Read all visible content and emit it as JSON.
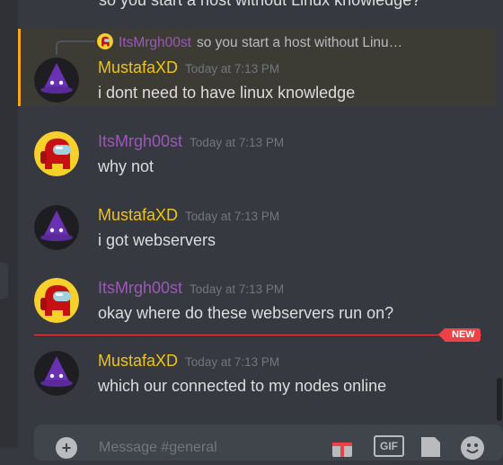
{
  "overflow_top_text": "so you start a host without Linux knowledge?",
  "reply": {
    "username": "ItsMrgh00st",
    "text": "so you start a host without Linu…"
  },
  "messages": [
    {
      "username": "MustafaXD",
      "timestamp": "Today at 7:13 PM",
      "text": "i dont need to have linux knowledge",
      "color": "#f1c40f",
      "avatar": "wizard-avatar"
    },
    {
      "username": "ItsMrgh00st",
      "timestamp": "Today at 7:13 PM",
      "text": "why not",
      "color": "#9b59b6",
      "avatar": "crewmate-avatar"
    },
    {
      "username": "MustafaXD",
      "timestamp": "Today at 7:13 PM",
      "text": "i got webservers",
      "color": "#f1c40f",
      "avatar": "wizard-avatar"
    },
    {
      "username": "ItsMrgh00st",
      "timestamp": "Today at 7:13 PM",
      "text": "okay where do these webservers run on?",
      "color": "#9b59b6",
      "avatar": "crewmate-avatar"
    },
    {
      "username": "MustafaXD",
      "timestamp": "Today at 7:13 PM",
      "text": "which our connected to my nodes online",
      "color": "#f1c40f",
      "avatar": "wizard-avatar"
    }
  ],
  "new_badge": "NEW",
  "composer": {
    "placeholder": "Message #general",
    "gif_label": "GIF"
  },
  "colors": {
    "background": "#36393f",
    "mention_highlight": "#3c3c35",
    "mention_bar": "#faa61a",
    "new_divider": "#ed4245"
  }
}
